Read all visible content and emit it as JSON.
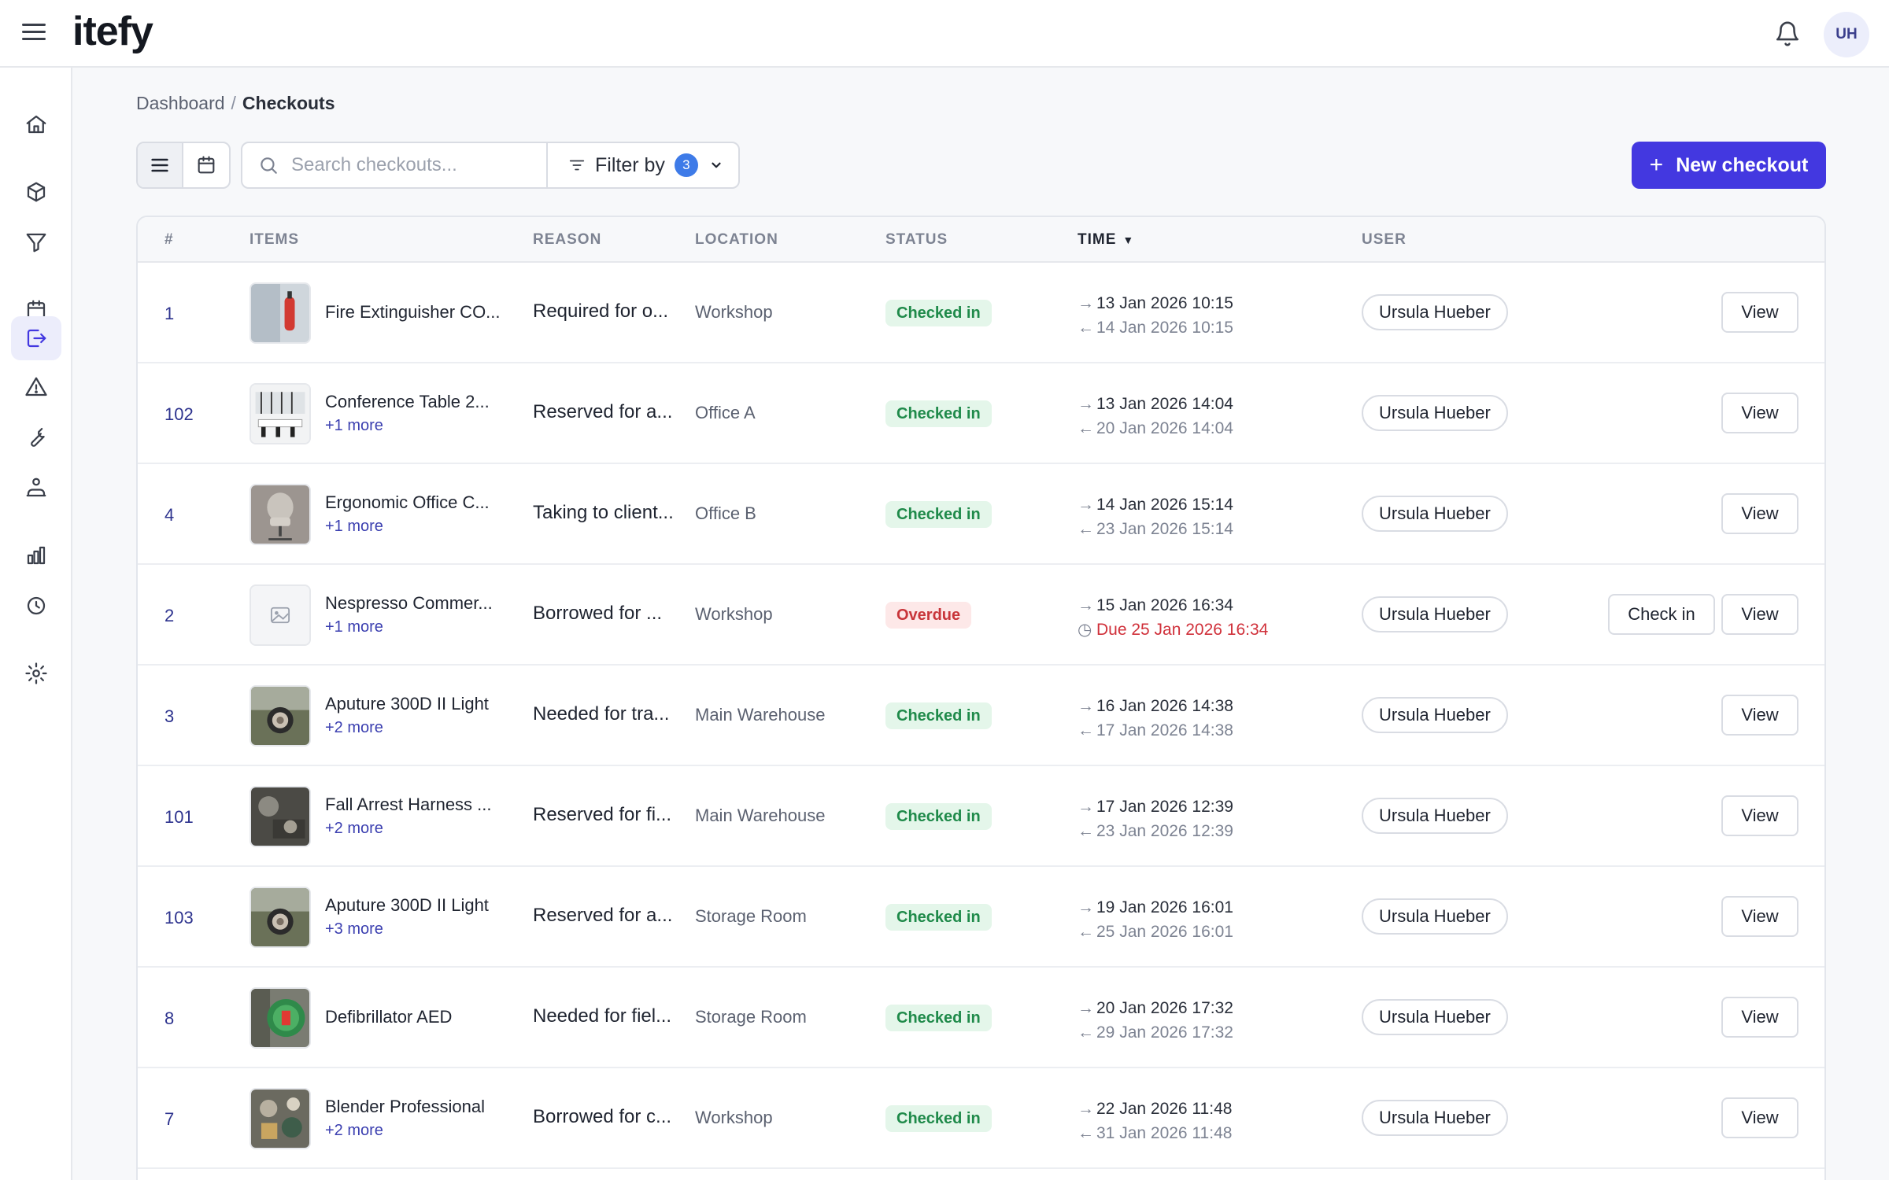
{
  "app": {
    "logo": "itefy",
    "avatar_initials": "UH"
  },
  "breadcrumb": {
    "parent": "Dashboard",
    "separator": "/",
    "current": "Checkouts"
  },
  "toolbar": {
    "search_placeholder": "Search checkouts...",
    "filter_label": "Filter by",
    "filter_count": "3",
    "new_button_label": "New checkout"
  },
  "table": {
    "headers": {
      "num": "#",
      "items": "ITEMS",
      "reason": "REASON",
      "location": "LOCATION",
      "status": "STATUS",
      "time": "TIME",
      "user": "USER"
    },
    "view_label": "View",
    "checkin_label": "Check in",
    "rows": [
      {
        "num": "1",
        "item": "Fire Extinguisher CO...",
        "more": "",
        "reason": "Required for o...",
        "location": "Workshop",
        "status": "Checked in",
        "status_type": "in",
        "out_time": "13 Jan 2026 10:15",
        "in_time": "14 Jan 2026 10:15",
        "user": "Ursula Hueber",
        "thumb": "extinguisher"
      },
      {
        "num": "102",
        "item": "Conference Table 2...",
        "more": "+1 more",
        "reason": "Reserved for a...",
        "location": "Office A",
        "status": "Checked in",
        "status_type": "in",
        "out_time": "13 Jan 2026 14:04",
        "in_time": "20 Jan 2026 14:04",
        "user": "Ursula Hueber",
        "thumb": "conference"
      },
      {
        "num": "4",
        "item": "Ergonomic Office C...",
        "more": "+1 more",
        "reason": "Taking to client...",
        "location": "Office B",
        "status": "Checked in",
        "status_type": "in",
        "out_time": "14 Jan 2026 15:14",
        "in_time": "23 Jan 2026 15:14",
        "user": "Ursula Hueber",
        "thumb": "chair"
      },
      {
        "num": "2",
        "item": "Nespresso Commer...",
        "more": "+1 more",
        "reason": "Borrowed for ...",
        "location": "Workshop",
        "status": "Overdue",
        "status_type": "overdue",
        "out_time": "15 Jan 2026 16:34",
        "in_time": "Due 25 Jan 2026 16:34",
        "user": "Ursula Hueber",
        "thumb": "placeholder"
      },
      {
        "num": "3",
        "item": "Aputure 300D II Light",
        "more": "+2 more",
        "reason": "Needed for tra...",
        "location": "Main Warehouse",
        "status": "Checked in",
        "status_type": "in",
        "out_time": "16 Jan 2026 14:38",
        "in_time": "17 Jan 2026 14:38",
        "user": "Ursula Hueber",
        "thumb": "light"
      },
      {
        "num": "101",
        "item": "Fall Arrest Harness ...",
        "more": "+2 more",
        "reason": "Reserved for fi...",
        "location": "Main Warehouse",
        "status": "Checked in",
        "status_type": "in",
        "out_time": "17 Jan 2026 12:39",
        "in_time": "23 Jan 2026 12:39",
        "user": "Ursula Hueber",
        "thumb": "harness"
      },
      {
        "num": "103",
        "item": "Aputure 300D II Light",
        "more": "+3 more",
        "reason": "Reserved for a...",
        "location": "Storage Room",
        "status": "Checked in",
        "status_type": "in",
        "out_time": "19 Jan 2026 16:01",
        "in_time": "25 Jan 2026 16:01",
        "user": "Ursula Hueber",
        "thumb": "light"
      },
      {
        "num": "8",
        "item": "Defibrillator AED",
        "more": "",
        "reason": "Needed for fiel...",
        "location": "Storage Room",
        "status": "Checked in",
        "status_type": "in",
        "out_time": "20 Jan 2026 17:32",
        "in_time": "29 Jan 2026 17:32",
        "user": "Ursula Hueber",
        "thumb": "aed"
      },
      {
        "num": "7",
        "item": "Blender Professional",
        "more": "+2 more",
        "reason": "Borrowed for c...",
        "location": "Workshop",
        "status": "Checked in",
        "status_type": "in",
        "out_time": "22 Jan 2026 11:48",
        "in_time": "31 Jan 2026 11:48",
        "user": "Ursula Hueber",
        "thumb": "blender"
      }
    ]
  },
  "sidebar": {
    "icons": [
      "home-icon",
      "box-icon",
      "funnel-icon",
      "calendar-icon",
      "checkout-icon",
      "warning-icon",
      "wrench-icon",
      "org-chart-icon",
      "bar-chart-icon",
      "history-icon",
      "gear-icon"
    ],
    "active": "checkout-icon"
  },
  "colors": {
    "accent": "#4338e0",
    "checked_in_bg": "#e4f6ea",
    "checked_in_text": "#1f8a4a",
    "overdue_bg": "#fde8e8",
    "overdue_text": "#c8353a"
  }
}
